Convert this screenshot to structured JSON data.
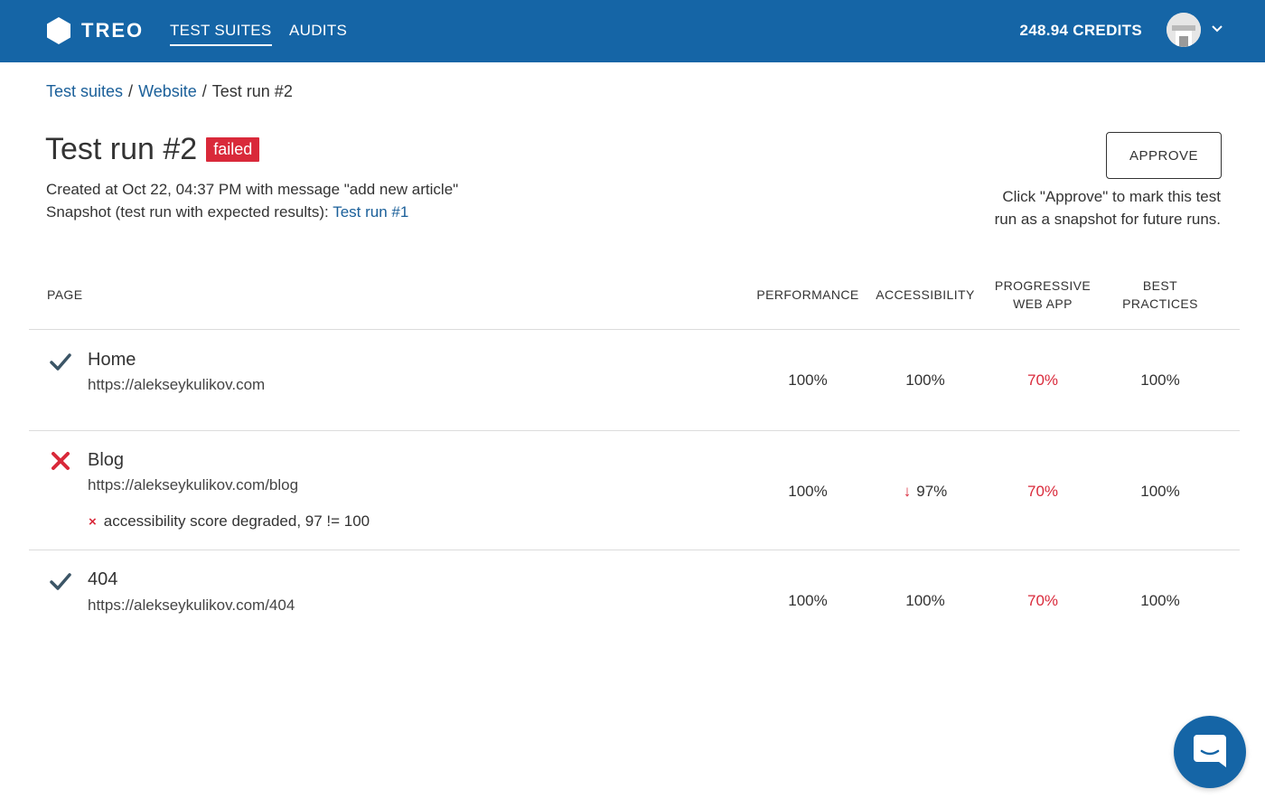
{
  "header": {
    "logo_text": "TREO",
    "nav": [
      {
        "label": "TEST SUITES",
        "active": true
      },
      {
        "label": "AUDITS",
        "active": false
      }
    ],
    "credits": "248.94 CREDITS"
  },
  "breadcrumb": {
    "items": [
      "Test suites",
      "Website"
    ],
    "separator": "/",
    "current": "Test run #2"
  },
  "run": {
    "title": "Test run #2",
    "status": "failed",
    "created": "Created at Oct 22, 04:37 PM with message \"add new article\"",
    "snapshot_prefix": "Snapshot (test run with expected results): ",
    "snapshot_link": "Test run #1"
  },
  "approve": {
    "label": "APPROVE",
    "hint_line1": "Click \"Approve\" to mark this test",
    "hint_line2": "run as a snapshot for future runs."
  },
  "table": {
    "columns": {
      "page": "PAGE",
      "performance": "PERFORMANCE",
      "accessibility": "ACCESSIBILITY",
      "pwa_line1": "PROGRESSIVE",
      "pwa_line2": "WEB APP",
      "bp_line1": "BEST",
      "bp_line2": "PRACTICES"
    },
    "rows": [
      {
        "status": "pass",
        "status_icon": "check-icon",
        "name": "Home",
        "url": "https://alekseykulikov.com",
        "performance": "100%",
        "accessibility": "100%",
        "pwa": "70%",
        "best_practices": "100%"
      },
      {
        "status": "fail",
        "status_icon": "cross-icon",
        "name": "Blog",
        "url": "https://alekseykulikov.com/blog",
        "error_mark": "×",
        "error": "accessibility score degraded, 97 != 100",
        "performance": "100%",
        "accessibility_arrow": "↓",
        "accessibility": "97%",
        "pwa": "70%",
        "best_practices": "100%"
      },
      {
        "status": "pass",
        "status_icon": "check-icon",
        "name": "404",
        "url": "https://alekseykulikov.com/404",
        "performance": "100%",
        "accessibility": "100%",
        "pwa": "70%",
        "best_practices": "100%"
      }
    ]
  },
  "colors": {
    "brand": "#1565a6",
    "link": "#1a5f99",
    "danger": "#d9293a",
    "check": "#3b5566"
  }
}
